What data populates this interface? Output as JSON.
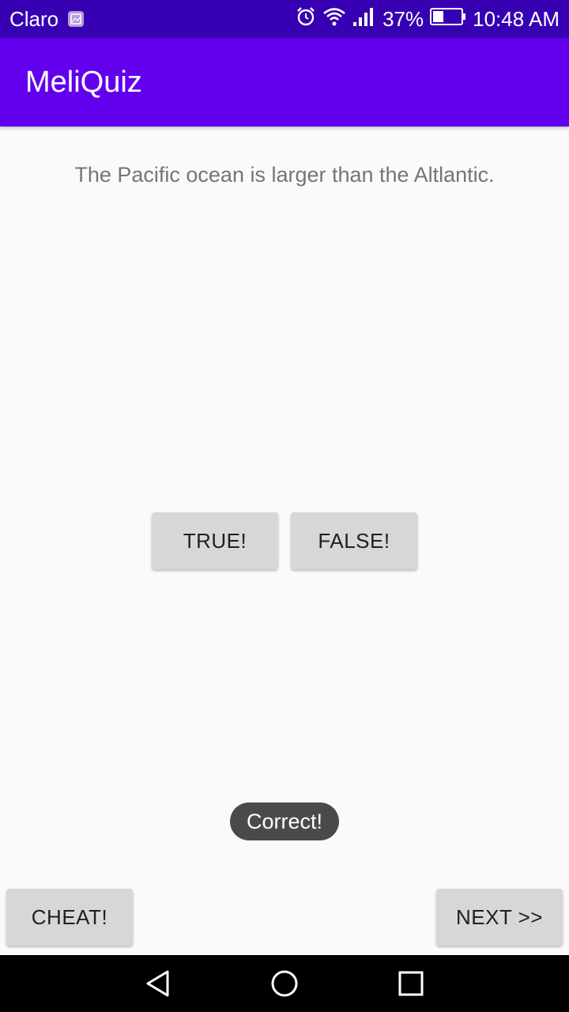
{
  "status_bar": {
    "carrier": "Claro",
    "battery": "37%",
    "time": "10:48 AM",
    "icons": [
      "image-icon",
      "alarm-icon",
      "wifi-icon",
      "signal-icon",
      "battery-icon"
    ]
  },
  "app_bar": {
    "title": "MeliQuiz"
  },
  "question": {
    "text": "The Pacific ocean is larger than the Altlantic."
  },
  "answers": {
    "true_label": "TRUE!",
    "false_label": "FALSE!"
  },
  "toast": {
    "text": "Correct!"
  },
  "footer": {
    "cheat_label": "CHEAT!",
    "next_label": "NEXT >>"
  },
  "colors": {
    "status_bar": "#3700b3",
    "app_bar": "#6200ee",
    "button": "#d6d7d7",
    "toast": "#4a4a4a",
    "background": "#fafafa"
  }
}
